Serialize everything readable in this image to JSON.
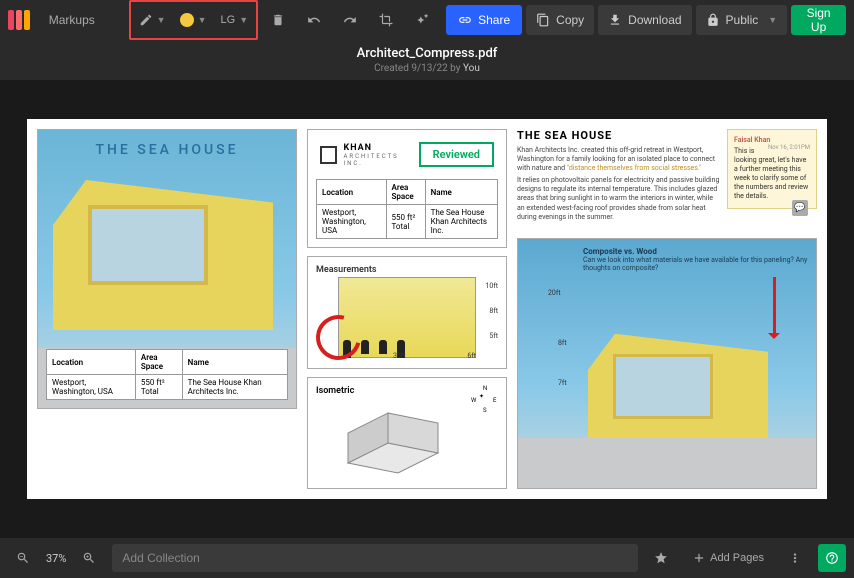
{
  "toolbar": {
    "markups_label": "Markups",
    "size_label": "LG",
    "share_label": "Share",
    "copy_label": "Copy",
    "download_label": "Download",
    "public_label": "Public",
    "signup_label": "Sign Up"
  },
  "document": {
    "title": "Architect_Compress.pdf",
    "created_prefix": "Created 9/13/22 by ",
    "created_by": "You"
  },
  "page": {
    "seahouse_title": "THE SEA HOUSE",
    "info_headers": {
      "location": "Location",
      "area": "Area Space",
      "name": "Name"
    },
    "info_values": {
      "location": "Westport, Washington, USA",
      "area": "550 ft² Total",
      "name": "The Sea House Khan Architects Inc."
    },
    "khan_name": "KHAN",
    "khan_sub": "ARCHITECTS INC.",
    "reviewed_label": "Reviewed",
    "measurements_title": "Measurements",
    "meas_labels": {
      "h10": "10ft",
      "h8": "8ft",
      "h5": "5ft",
      "w30": "30ft",
      "w6": "6ft"
    },
    "isometric_title": "Isometric",
    "compass": {
      "n": "N",
      "s": "S",
      "e": "E",
      "w": "W"
    },
    "col3_title": "THE SEA HOUSE",
    "col3_desc": "Khan Architects Inc. created this off-grid retreat in Westport, Washington for a family looking for an isolated place to connect with nature and ",
    "col3_highlight": "\"distance themselves from social stresses.\"",
    "col3_desc2": "It relies on photovoltaic panels for electricity and passive building designs to regulate its internal temperature. This includes glazed areas that bring sunlight in to warm the interiors in winter, while an extended west-facing roof provides shade from solar heat during evenings in the summer.",
    "composite_title": "Composite vs. Wood",
    "composite_text": "Can we look into what materials we have available for this paneling? Any thoughts on composite?",
    "axis_labels": {
      "a7": "7ft",
      "a8": "8ft",
      "a20": "20ft"
    },
    "comment": {
      "author": "Faisal Khan",
      "time": "Nov 16, 2:01PM",
      "text": "This is looking great, let's have a further meeting this week to clarify some of the numbers and review the details."
    }
  },
  "bottombar": {
    "zoom_pct": "37%",
    "collection_placeholder": "Add Collection",
    "add_pages_label": "Add Pages"
  }
}
